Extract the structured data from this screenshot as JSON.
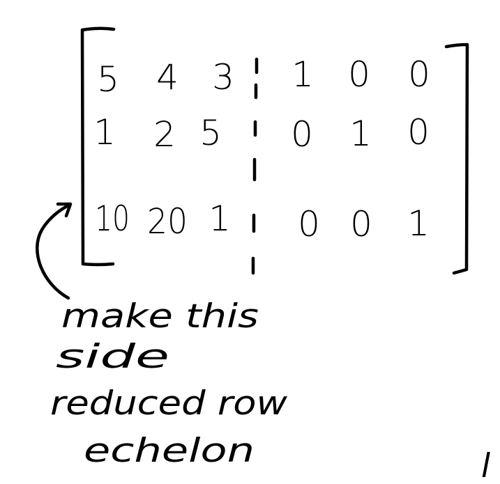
{
  "matrix": {
    "rows": [
      {
        "left": [
          "5",
          "4",
          "3"
        ],
        "right": [
          "1",
          "0",
          "0"
        ]
      },
      {
        "left": [
          "1",
          "2",
          "5"
        ],
        "right": [
          "0",
          "1",
          "0"
        ]
      },
      {
        "left": [
          "10",
          "20",
          "1"
        ],
        "right": [
          "0",
          "0",
          "1"
        ]
      }
    ]
  },
  "note": {
    "lines": [
      "make this",
      "side",
      "reduced row",
      "echelon"
    ]
  },
  "edge_fragment": "l"
}
